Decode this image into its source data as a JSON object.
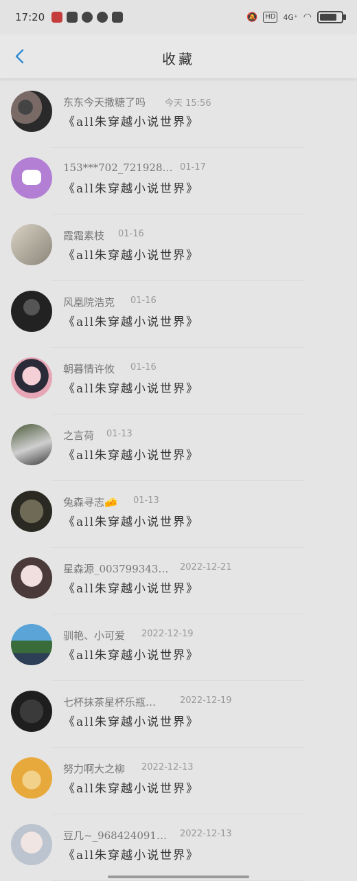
{
  "status": {
    "time": "17:20",
    "network": "4G⁺",
    "hd": "HD"
  },
  "header": {
    "title": "收藏"
  },
  "items": [
    {
      "name": "东东今天撒糖了吗",
      "time": "今天 15:56",
      "message": "《all朱穿越小说世界》"
    },
    {
      "name": "153***702_7219280…",
      "time": "01-17",
      "message": "《all朱穿越小说世界》"
    },
    {
      "name": "霞霜素枝",
      "time": "01-16",
      "message": "《all朱穿越小说世界》"
    },
    {
      "name": "风凰院浩克",
      "time": "01-16",
      "message": "《all朱穿越小说世界》"
    },
    {
      "name": "朝暮情许攸",
      "time": "01-16",
      "message": "《all朱穿越小说世界》"
    },
    {
      "name": "之言荷",
      "time": "01-13",
      "message": "《all朱穿越小说世界》"
    },
    {
      "name": "兔森寻志🧀",
      "time": "01-13",
      "message": "《all朱穿越小说世界》"
    },
    {
      "name": "星森源_003799343…",
      "time": "2022-12-21",
      "message": "《all朱穿越小说世界》"
    },
    {
      "name": "驯艳、小可爱",
      "time": "2022-12-19",
      "message": "《all朱穿越小说世界》"
    },
    {
      "name": "七杯抹茶星杯乐瓶…",
      "time": "2022-12-19",
      "message": "《all朱穿越小说世界》"
    },
    {
      "name": "努力啊大之柳",
      "time": "2022-12-13",
      "message": "《all朱穿越小说世界》"
    },
    {
      "name": "豆几~_9684240918…",
      "time": "2022-12-13",
      "message": "《all朱穿越小说世界》"
    }
  ],
  "colors": {
    "accent": "#2d8bd3",
    "background": "#e5e5e5"
  }
}
